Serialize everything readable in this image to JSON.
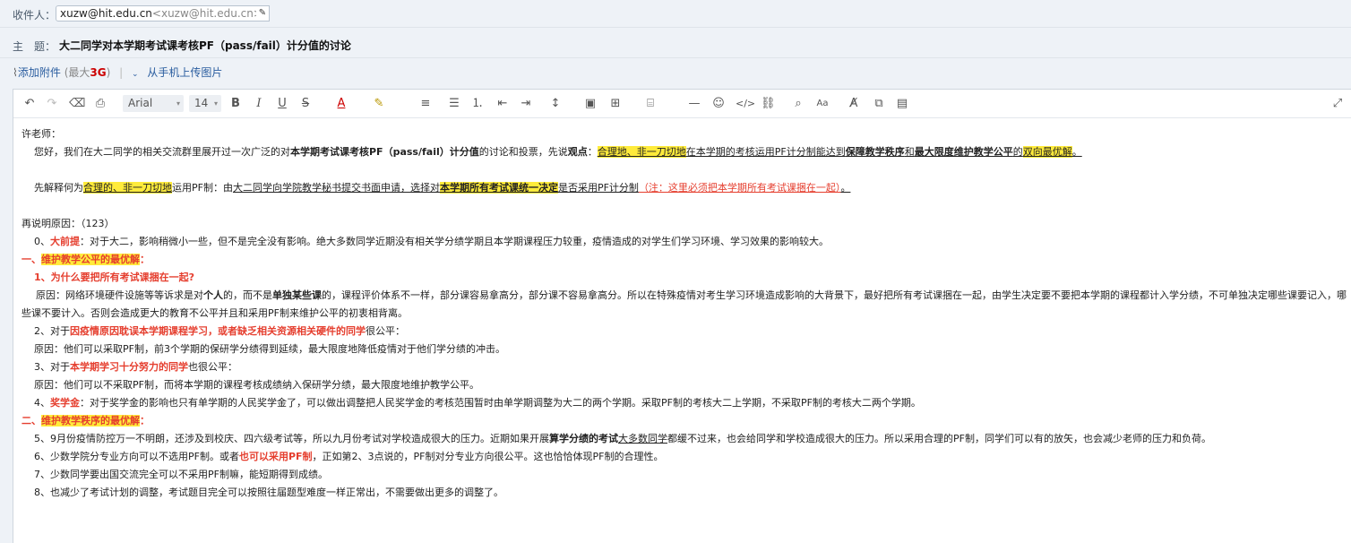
{
  "header": {
    "to_label": "收件人：",
    "to_name": "xuzw@hit.edu.cn",
    "to_addr": "<xuzw@hit.edu.cn>",
    "subject_label": "主　题：",
    "subject": "大二同学对本学期考试课考核PF（pass/fail）计分值的讨论",
    "attach_label": "添加附件",
    "attach_max_a": "(最大",
    "attach_max_b": "3G",
    "attach_max_c": ")",
    "mobile_label": "从手机上传图片"
  },
  "toolbar": {
    "font": "Arial",
    "size": "14"
  },
  "body": {
    "greeting": "许老师：",
    "p1": {
      "a": "您好，我们在大二同学的相关交流群里展开过一次广泛的对",
      "b": "本学期考试课考核PF（pass/fail）计分值",
      "c": "的讨论和投票，先说",
      "d": "观点",
      "e": "：",
      "f": "合理地、非一刀切地",
      "g": "在本学期的考核运用PF计分制能达到",
      "h": "保障教学秩序",
      "i": "和",
      "j": "最大限度维护教学公平",
      "k": "的",
      "l": "双向最优解",
      "m": "。"
    },
    "p2": {
      "a": "先解释何为",
      "b": "合理的、非一刀切地",
      "c": "运用PF制：由",
      "d": "大二同学向学院教学秘书提交书面申请，选择对",
      "e": "本学期所有考试课统一决定",
      "f": "是否采用PF计分制",
      "g": "（注：这里必须把本学期所有考试课捆在一起）",
      "h": "。"
    },
    "reasons_title": "再说明原因：（123）",
    "r0_a": "0、",
    "r0_b": "大前提",
    "r0_c": "：对于大二，影响稍微小一些，但不是完全没有影响。绝大多数同学近期没有相关学分绩学期且本学期课程压力较重，疫情造成的对学生们学习环境、学习效果的影响较大。",
    "s1_a": "一、",
    "s1_b": "维护教学公平的最优解",
    "s1_c": "：",
    "q1": "1、为什么要把所有考试课捆在一起?",
    "q1_reason_a": "原因：网络环境硬件设施等等诉求是对",
    "q1_reason_b": "个人",
    "q1_reason_c": "的，而不是",
    "q1_reason_d": "单独某些课",
    "q1_reason_e": "的，课程评价体系不一样，部分课容易拿高分，部分课不容易拿高分。所以在特殊疫情对考生学习环境造成影响的大背景下，最好把所有考试课捆在一起，由学生决定要不要把本学期的课程都计入学分绩，不可单独决定哪些课要记入，哪些课不要计入。否则会造成更大的教育不公平并且和采用PF制来维护公平的初衷相背离。",
    "q2_a": "2、对于",
    "q2_b": "因疫情原因耽误本学期课程学习，或者缺乏相关资源相关硬件的同学",
    "q2_c": "很公平：",
    "q2_reason": "原因：他们可以采取PF制，前3个学期的保研学分绩得到延续，最大限度地降低疫情对于他们学分绩的冲击。",
    "q3_a": "3、对于",
    "q3_b": "本学期学习十分努力的同学",
    "q3_c": "也很公平：",
    "q3_reason": "原因：他们可以不采取PF制，而将本学期的课程考核成绩纳入保研学分绩，最大限度地维护教学公平。",
    "q4_a": "4、",
    "q4_b": "奖学金",
    "q4_c": "：对于奖学金的影响也只有单学期的人民奖学金了，可以做出调整把人民奖学金的考核范围暂时由单学期调整为大二的两个学期。采取PF制的考核大二上学期，不采取PF制的考核大二两个学期。",
    "s2_a": "二、",
    "s2_b": "维护教学秩序的最优解",
    "s2_c": "：",
    "q5_a": "5、9月份疫情防控万一不明朗，还涉及到校庆、四六级考试等，所以九月份考试对学校造成很大的压力。近期如果开展",
    "q5_b": "算学分绩的考试",
    "q5_c": "大多数同学",
    "q5_d": "都缓不过来，也会给同学和学校造成很大的压力。所以采用合理的PF制，同学们可以有的放矢，也会减少老师的压力和负荷。",
    "q6_a": "6、少数学院分专业方向可以不选用PF制。或者",
    "q6_b": "也可以采用PF制",
    "q6_c": "，正如第2、3点说的，PF制对分专业方向很公平。这也恰恰体现PF制的合理性。",
    "q7": "7、少数同学要出国交流完全可以不采用PF制嘛，能短期得到成绩。",
    "q8": "8、也减少了考试计划的调整，考试题目完全可以按照往届题型难度一样正常出，不需要做出更多的调整了。"
  }
}
